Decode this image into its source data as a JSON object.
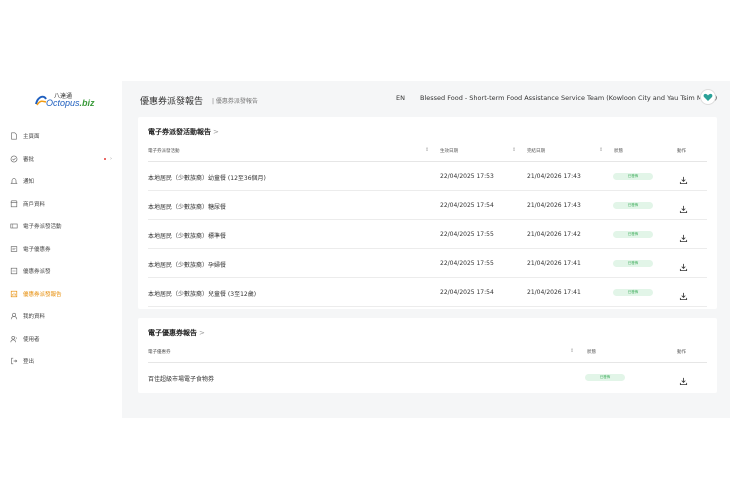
{
  "logo": {
    "cn": "八達通",
    "brand": "Octopus",
    "biz": ".biz"
  },
  "sidebar": {
    "items": [
      {
        "label": "主頁面",
        "icon": "document-icon"
      },
      {
        "label": "審批",
        "icon": "check-circle-icon"
      },
      {
        "label": "通知",
        "icon": "bell-icon"
      },
      {
        "label": "商戶資料",
        "icon": "store-icon"
      },
      {
        "label": "電子券派發活動",
        "icon": "coupon-icon"
      },
      {
        "label": "電子優惠券",
        "icon": "voucher-icon"
      },
      {
        "label": "優惠券派發",
        "icon": "distribute-icon"
      },
      {
        "label": "優惠券派發報告",
        "icon": "report-icon"
      },
      {
        "label": "我的資料",
        "icon": "user-icon"
      },
      {
        "label": "使用者",
        "icon": "users-icon"
      },
      {
        "label": "登出",
        "icon": "logout-icon"
      }
    ]
  },
  "header": {
    "title": "優惠券派發報告",
    "breadcrumb": "| 優惠券派發報告",
    "lang": "EN",
    "org": "Blessed Food - Short-term Food Assistance Service Team (Kowloon City and Yau Tsim Mong)"
  },
  "report1": {
    "title": "電子券派發活動報告",
    "arrow": ">",
    "columns": {
      "name": "電子券派發活動",
      "start": "生效日期",
      "end": "完結日期",
      "status": "狀態",
      "action": "動作"
    },
    "rows": [
      {
        "name": "本地居民（少數族裔）幼童餐 (12至36個月)",
        "start": "22/04/2025 17:53",
        "end": "21/04/2026 17:43",
        "status": "已發佈"
      },
      {
        "name": "本地居民（少數族裔）糖尿餐",
        "start": "22/04/2025 17:54",
        "end": "21/04/2026 17:43",
        "status": "已發佈"
      },
      {
        "name": "本地居民（少數族裔）標準餐",
        "start": "22/04/2025 17:55",
        "end": "21/04/2026 17:42",
        "status": "已發佈"
      },
      {
        "name": "本地居民（少數族裔）孕婦餐",
        "start": "22/04/2025 17:55",
        "end": "21/04/2026 17:41",
        "status": "已發佈"
      },
      {
        "name": "本地居民（少數族裔）兒童餐 (3至12歲)",
        "start": "22/04/2025 17:54",
        "end": "21/04/2026 17:41",
        "status": "已發佈"
      }
    ]
  },
  "report2": {
    "title": "電子優惠券報告",
    "arrow": ">",
    "columns": {
      "name": "電子優惠券",
      "status": "狀態",
      "action": "動作"
    },
    "rows": [
      {
        "name": "百佳超級市場電子食物券",
        "status": "已發佈"
      }
    ]
  },
  "colors": {
    "accent": "#e68a00",
    "status_bg": "#e2f5e8",
    "status_text": "#34a853",
    "main_bg": "#f5f6f7"
  }
}
